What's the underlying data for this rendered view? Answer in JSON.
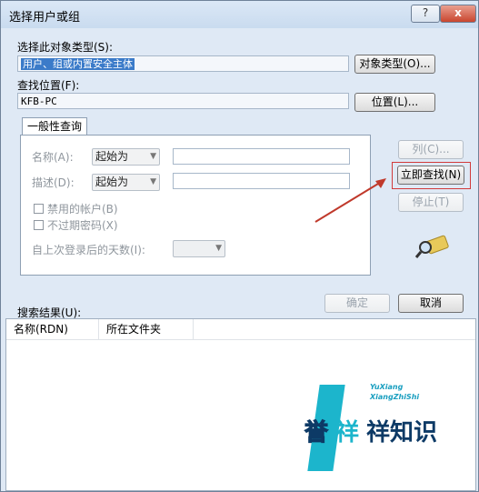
{
  "window": {
    "title": "选择用户或组",
    "help_label": "?",
    "close_label": "x"
  },
  "object_type": {
    "label": "选择此对象类型(S):",
    "value": "用户、组或内置安全主体",
    "button": "对象类型(O)..."
  },
  "location": {
    "label": "查找位置(F):",
    "value": "KFB-PC",
    "button": "位置(L)..."
  },
  "tab": {
    "label": "一般性查询",
    "name": {
      "label": "名称(A):",
      "mode": "起始为",
      "value": ""
    },
    "desc": {
      "label": "描述(D):",
      "mode": "起始为",
      "value": ""
    },
    "disabled_accounts": "禁用的帐户(B)",
    "no_expire_password": "不过期密码(X)",
    "days_since_login": {
      "label": "自上次登录后的天数(I):",
      "value": ""
    }
  },
  "side_buttons": {
    "columns": "列(C)...",
    "find_now": "立即查找(N)",
    "stop": "停止(T)"
  },
  "footer": {
    "ok": "确定",
    "cancel": "取消"
  },
  "results": {
    "label": "搜索结果(U):",
    "columns": [
      "名称(RDN)",
      "所在文件夹"
    ]
  },
  "watermark": {
    "line1": "YuXiang",
    "line2": "XiangZhiShi",
    "text_a": "誉",
    "text_b": "祥",
    "text_c": "祥知识"
  }
}
